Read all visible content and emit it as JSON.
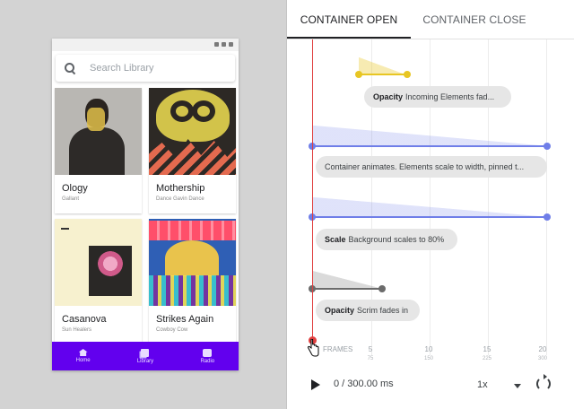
{
  "search": {
    "placeholder": "Search Library"
  },
  "albums": [
    {
      "title": "Ology",
      "artist": "Gallant"
    },
    {
      "title": "Mothership",
      "artist": "Dance Gavin Dance"
    },
    {
      "title": "Casanova",
      "artist": "Sun Healers"
    },
    {
      "title": "Strikes Again",
      "artist": "Cowboy Cow"
    }
  ],
  "bottom_nav": {
    "items": [
      "Home",
      "Library",
      "Radio"
    ]
  },
  "tabs": {
    "open": "CONTAINER OPEN",
    "close": "CONTAINER CLOSE",
    "active": "CONTAINER OPEN"
  },
  "tracks": [
    {
      "label": "Opacity",
      "description": "Incoming Elements fad...",
      "color": "#e8c623"
    },
    {
      "label": "",
      "description": "Container animates. Elements scale to width, pinned t...",
      "color": "#6f7ee8"
    },
    {
      "label": "Scale",
      "description": "Background scales to 80%",
      "color": "#6f7ee8"
    },
    {
      "label": "Opacity",
      "description": "Scrim fades in",
      "color": "#6b6b6b"
    }
  ],
  "ruler": {
    "frames_label": "FRAMES",
    "ticks": [
      {
        "frame": "5",
        "ms": "75"
      },
      {
        "frame": "10",
        "ms": "150"
      },
      {
        "frame": "15",
        "ms": "225"
      },
      {
        "frame": "20",
        "ms": "300"
      }
    ]
  },
  "playback": {
    "time": "0 / 300.00 ms",
    "speed": "1x",
    "progress": 0
  },
  "colors": {
    "accent": "#6200ee",
    "playhead": "#e04040",
    "lane": "#6f7ee8"
  }
}
